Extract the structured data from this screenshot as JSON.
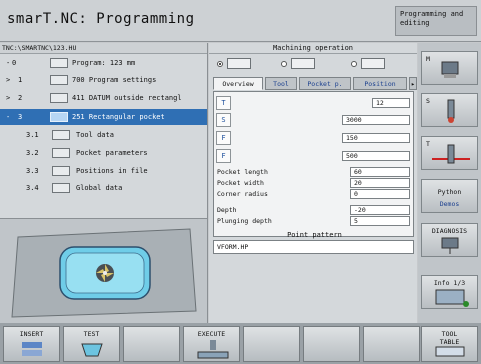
{
  "header": {
    "title": "smarT.NC: Programming",
    "mode": "Programming and editing"
  },
  "left": {
    "path": "TNC:\\SMARTNC\\123.HU",
    "tree": [
      {
        "num": "0",
        "arrow": "-",
        "label": "Program: 123 mm",
        "icon": "program-icon"
      },
      {
        "num": "1",
        "arrow": ">",
        "label": "700 Program settings",
        "icon": "settings-icon"
      },
      {
        "num": "2",
        "arrow": ">",
        "label": "411 DATUM outside rectangl",
        "icon": "datum-icon"
      },
      {
        "num": "3",
        "arrow": "-",
        "label": "251 Rectangular pocket",
        "icon": "pocket-icon",
        "selected": true
      },
      {
        "num": "3.1",
        "label": "Tool data",
        "icon": "tool-icon"
      },
      {
        "num": "3.2",
        "label": "Pocket parameters",
        "icon": "pocket-params-icon"
      },
      {
        "num": "3.3",
        "label": "Positions in file",
        "icon": "positions-icon"
      },
      {
        "num": "3.4",
        "label": "Global data",
        "icon": "global-icon"
      }
    ]
  },
  "right": {
    "section_title": "Machining operation",
    "tabs": [
      "Overview",
      "Tool",
      "Pocket p.",
      "Position"
    ],
    "fields": {
      "T": "12",
      "S": "3000",
      "F": "150",
      "F2": "500",
      "pocket_length": {
        "label": "Pocket length",
        "value": "60"
      },
      "pocket_width": {
        "label": "Pocket width",
        "value": "20"
      },
      "corner_radius": {
        "label": "Corner radius",
        "value": "0"
      },
      "depth": {
        "label": "Depth",
        "value": "-20"
      },
      "plunging_depth": {
        "label": "Plunging depth",
        "value": "5"
      }
    },
    "point_pattern": {
      "title": "Point pattern",
      "value": "VFORM.HP"
    }
  },
  "side_softkeys": {
    "m": "M",
    "s": "S",
    "t": "T",
    "python_line1": "Python",
    "python_line2": "Demos",
    "diagnosis": "DIAGNOSIS",
    "info": "Info 1/3"
  },
  "bottom_softkeys": {
    "insert": "INSERT",
    "test": "TEST",
    "execute": "EXECUTE",
    "tool_table_line1": "TOOL",
    "tool_table_line2": "TABLE"
  },
  "colors": {
    "selected_row": "#2f6fb4",
    "tab_text": "#1a3f8e"
  }
}
